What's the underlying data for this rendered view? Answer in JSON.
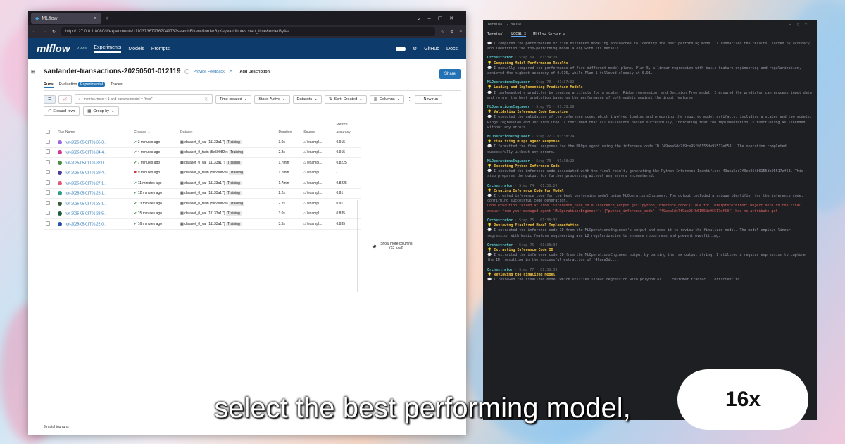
{
  "browser": {
    "tab_title": "MLflow",
    "url": "http://127.0.0.1:8080/#/experiments/111037367976704973?searchFilter=&orderByKey=attributes.start_time&orderByAs..."
  },
  "nav": {
    "logo": "mlflow",
    "version": "2.22.0",
    "items": [
      "Experiments",
      "Models",
      "Prompts"
    ],
    "right": [
      "GitHub",
      "Docs"
    ]
  },
  "experiment": {
    "title": "santander-transactions-20250501-012119",
    "feedback": "Provide Feedback",
    "add_description": "Add Description",
    "share": "Share"
  },
  "tabs": {
    "runs": "Runs",
    "evaluation": "Evaluation",
    "experimental": "Experimental",
    "traces": "Traces"
  },
  "toolbar": {
    "search_placeholder": "metrics.rmse < 1 and params.model = \"tree\"",
    "time_created": "Time created",
    "state": "State: Active",
    "datasets": "Datasets",
    "sort": "Sort: Created",
    "columns": "Columns",
    "new_run": "New run",
    "expand_rows": "Expand rows",
    "group_by": "Group by"
  },
  "table": {
    "metrics_header": "Metrics",
    "headers": [
      "Run Name",
      "Created",
      "Dataset",
      "Duration",
      "Source",
      "accuracy"
    ],
    "show_more": "Show more columns (13 total)",
    "rows": [
      {
        "name": "run-2025-05-01T01-35-3...",
        "color": "#9c6ade",
        "created": "3 minutes ago",
        "status": "ok",
        "dataset": "dataset_0_val (11133a17)",
        "tag": "Training",
        "duration": "3.0s",
        "source": "\\exampl...",
        "accuracy": "0.915"
      },
      {
        "name": "run-2025-05-01T01-34-4...",
        "color": "#d6339a",
        "created": "4 minutes ago",
        "status": "ok",
        "dataset": "dataset_0_train (5e59082e)",
        "tag": "Training",
        "duration": "2.8s",
        "source": "\\exampl...",
        "accuracy": "0.915"
      },
      {
        "name": "run-2025-05-01T01-32-0...",
        "color": "#4a8f3a",
        "created": "7 minutes ago",
        "status": "ok",
        "dataset": "dataset_0_val (11133a17)",
        "tag": "Training",
        "duration": "1.7min",
        "source": "\\exampl...",
        "accuracy": "0.8225"
      },
      {
        "name": "run-2025-05-01T01-29-4...",
        "color": "#4b3c9e",
        "created": "9 minutes ago",
        "status": "fail",
        "dataset": "dataset_0_train (5e59082e)",
        "tag": "Training",
        "duration": "1.7min",
        "source": "\\exampl...",
        "accuracy": "-"
      },
      {
        "name": "run-2025-05-01T01-27-1...",
        "color": "#e8547a",
        "created": "11 minutes ago",
        "status": "ok",
        "dataset": "dataset_0_val (11133a17)",
        "tag": "Training",
        "duration": "1.7min",
        "source": "\\exampl...",
        "accuracy": "0.8225"
      },
      {
        "name": "run-2025-05-01T01-26-1...",
        "color": "#2e9c8c",
        "created": "12 minutes ago",
        "status": "ok",
        "dataset": "dataset_0_val (11133a17)",
        "tag": "Training",
        "duration": "2.2s",
        "source": "\\exampl...",
        "accuracy": "0.91"
      },
      {
        "name": "run-2025-05-01T01-25-1...",
        "color": "#3b5b3b",
        "created": "13 minutes ago",
        "status": "ok",
        "dataset": "dataset_0_train (5e59082e)",
        "tag": "Training",
        "duration": "2.2s",
        "source": "\\exampl...",
        "accuracy": "0.91"
      },
      {
        "name": "run-2025-05-01T01-23-5...",
        "color": "#1f5c3a",
        "created": "15 minutes ago",
        "status": "ok",
        "dataset": "dataset_0_val (11133a17)",
        "tag": "Training",
        "duration": "3.0s",
        "source": "\\exampl...",
        "accuracy": "0.835"
      },
      {
        "name": "run-2025-05-01T01-22-0...",
        "color": "#2a4fa8",
        "created": "16 minutes ago",
        "status": "ok",
        "dataset": "dataset_0_val (11133a17)",
        "tag": "Training",
        "duration": "3.3s",
        "source": "\\exampl...",
        "accuracy": "0.835"
      }
    ]
  },
  "footer": "9 matching runs",
  "terminal": {
    "title": "Terminal - pause",
    "tabs": [
      "Terminal",
      "Local",
      "MLflow Server"
    ],
    "entries": [
      {
        "msg": "I compared the performances of five different modeling approaches to identify the best performing model. I summarized the results, sorted by accuracy, and identified the top-performing model along with its details."
      },
      {
        "agent": "Orchestrator",
        "step": "· Step 69 · 01:34:29",
        "heading": "Comparing Model Performance Results",
        "msg": "I manually compared the performance of five different model plans. Plan 5, a linear regression with basic feature engineering and regularization, achieved the highest accuracy of 0.915, while Plan 1 followed closely at 0.91."
      },
      {
        "agent": "MLOperationsEngineer",
        "step": "· Step 70 · 01:37:02",
        "heading": "Loading and Implementing Prediction Models",
        "msg": "I implemented a predictor by loading artifacts for a scaler, Ridge regression, and Decision Tree model. I ensured the predictor can process input data and return the best prediction based on the performance of both models against the input features."
      },
      {
        "agent": "MLOperationsEngineer",
        "step": "· Step 71 · 01:38:19",
        "heading": "Validating Inference Code Execution",
        "msg": "I executed the validation of the inference code, which involved loading and preparing the required model artifacts, including a scaler and two models: Ridge regression and Decision Tree. I confirmed that all validators passed successfully, indicating that the implementation is functioning as intended without any errors."
      },
      {
        "agent": "MLOperationsEngineer",
        "step": "· Step 72 · 01:38:24",
        "heading": "Finalizing MLOps Agent Response",
        "msg": "I formatted the final response for the MLOps agent using the inference code ID '49aea5dc7f9ce95fb6155de95517ef58'. The operation completed successfully without any errors."
      },
      {
        "agent": "MLOperationsEngineer",
        "step": "· Step 73 · 01:38:29",
        "heading": "Executing Python Inference Code",
        "msg": "I executed the inference code associated with the final result, generating the Python Inference Identifier: 49aea5dc7f9ce95fb6155de95517ef58. This step prepares the output for further processing without any errors encountered."
      },
      {
        "agent": "Orchestrator",
        "step": "· Step 74 · 01:38:29",
        "heading": "Creating Inference Code For Model",
        "msg": "I created inference code for the best performing model using MLOperationsEngineer. The output included a unique identifier for the inference code, confirming successful code generation.",
        "error": "Code execution failed at line 'inference_code_id = inference_output.get(\"python_inference_code\")' due to: InterpreterError: Object here in the final answer from your managed agent 'MLOperationsEngineer': {\"python_inference_code\": \"49aea5dc7f9ce95fb6155de95517ef58\"} has no attribute get"
      },
      {
        "agent": "Orchestrator",
        "step": "· Step 75 · 01:38:32",
        "heading": "Reviewing Finalized Model Implementation",
        "msg": "I extracted the inference code ID from the MLOperationsEngineer's output and used it to review the finalized model. The model employs linear regression with basic feature engineering and L2 regularization to enhance robustness and prevent overfitting."
      },
      {
        "agent": "Orchestrator",
        "step": "· Step 76 · 01:38:34",
        "heading": "Extracting Inference Code ID",
        "msg": "I extracted the inference code ID from the MLOperationsEngineer output by parsing the raw output string. I utilized a regular expression to capture the ID, resulting in the successful extraction of '49aea5dc..."
      },
      {
        "agent": "Orchestrator",
        "step": "· Step 77 · 01:38:39",
        "heading": "Reviewing the Finalized Model",
        "msg": "I reviewed the finalized model which utilizes linear regression with polynomial ... customer transac... efficient to..."
      }
    ]
  },
  "caption": "select the best performing model,",
  "speed": "16x"
}
